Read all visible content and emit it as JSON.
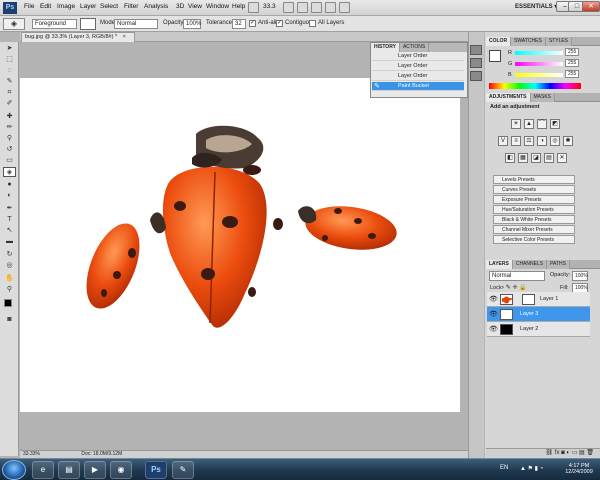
{
  "menu": {
    "logo": "Ps",
    "items": [
      "File",
      "Edit",
      "Image",
      "Layer",
      "Select",
      "Filter",
      "Analysis",
      "3D",
      "View",
      "Window",
      "Help"
    ],
    "zoom": "33.3",
    "essentials": "ESSENTIALS ▾",
    "win": {
      "min": "–",
      "max": "□",
      "close": "✕"
    }
  },
  "options": {
    "mode_source": "Foreground",
    "mode_label": "Mode:",
    "mode": "Normal",
    "opacity_label": "Opacity:",
    "opacity": "100%",
    "tolerance_label": "Tolerance:",
    "tolerance": "32",
    "antialias": "Anti-alias",
    "contiguous": "Contiguous",
    "all_layers": "All Layers"
  },
  "document": {
    "tab": "bug.jpg @ 33.3% (Layer 3, RGB/8#) *",
    "close": "×",
    "status_zoom": "33.33%",
    "status_doc": "Doc: 18.0M/9.12M"
  },
  "history": {
    "tabs": [
      "HISTORY",
      "ACTIONS"
    ],
    "rows": [
      {
        "label": "Layer Order",
        "selected": false
      },
      {
        "label": "Layer Order",
        "selected": false
      },
      {
        "label": "Layer Order",
        "selected": false
      },
      {
        "label": "Paint Bucket",
        "selected": true
      }
    ]
  },
  "color_panel": {
    "tabs": [
      "COLOR",
      "SWATCHES",
      "STYLES"
    ],
    "channels": [
      {
        "name": "R",
        "value": "255"
      },
      {
        "name": "G",
        "value": "255"
      },
      {
        "name": "B",
        "value": "255"
      }
    ],
    "foreground": "#ffffff",
    "background": "#000000"
  },
  "adjustments": {
    "tabs": [
      "ADJUSTMENTS",
      "MASKS"
    ],
    "title": "Add an adjustment",
    "presets": [
      "Levels Presets",
      "Curves Presets",
      "Exposure Presets",
      "Hue/Saturation Presets",
      "Black & White Presets",
      "Channel Mixer Presets",
      "Selective Color Presets"
    ]
  },
  "layers": {
    "tabs": [
      "LAYERS",
      "CHANNELS",
      "PATHS"
    ],
    "blend": "Normal",
    "opacity_label": "Opacity:",
    "opacity": "100%",
    "lock_label": "Lock:",
    "fill_label": "Fill:",
    "fill": "100%",
    "rows": [
      {
        "name": "Layer 1",
        "selected": false,
        "thumb": "bug"
      },
      {
        "name": "Layer 3",
        "selected": true,
        "thumb": "white"
      },
      {
        "name": "Layer 2",
        "selected": false,
        "thumb": "black"
      }
    ]
  },
  "taskbar": {
    "lang": "EN",
    "time": "4:17 PM",
    "date": "12/24/2009",
    "ps_label": "Ps"
  },
  "colors": {
    "accent": "#3b93e8",
    "bug_red": "#e8420c",
    "spots": "#3a1a12"
  }
}
